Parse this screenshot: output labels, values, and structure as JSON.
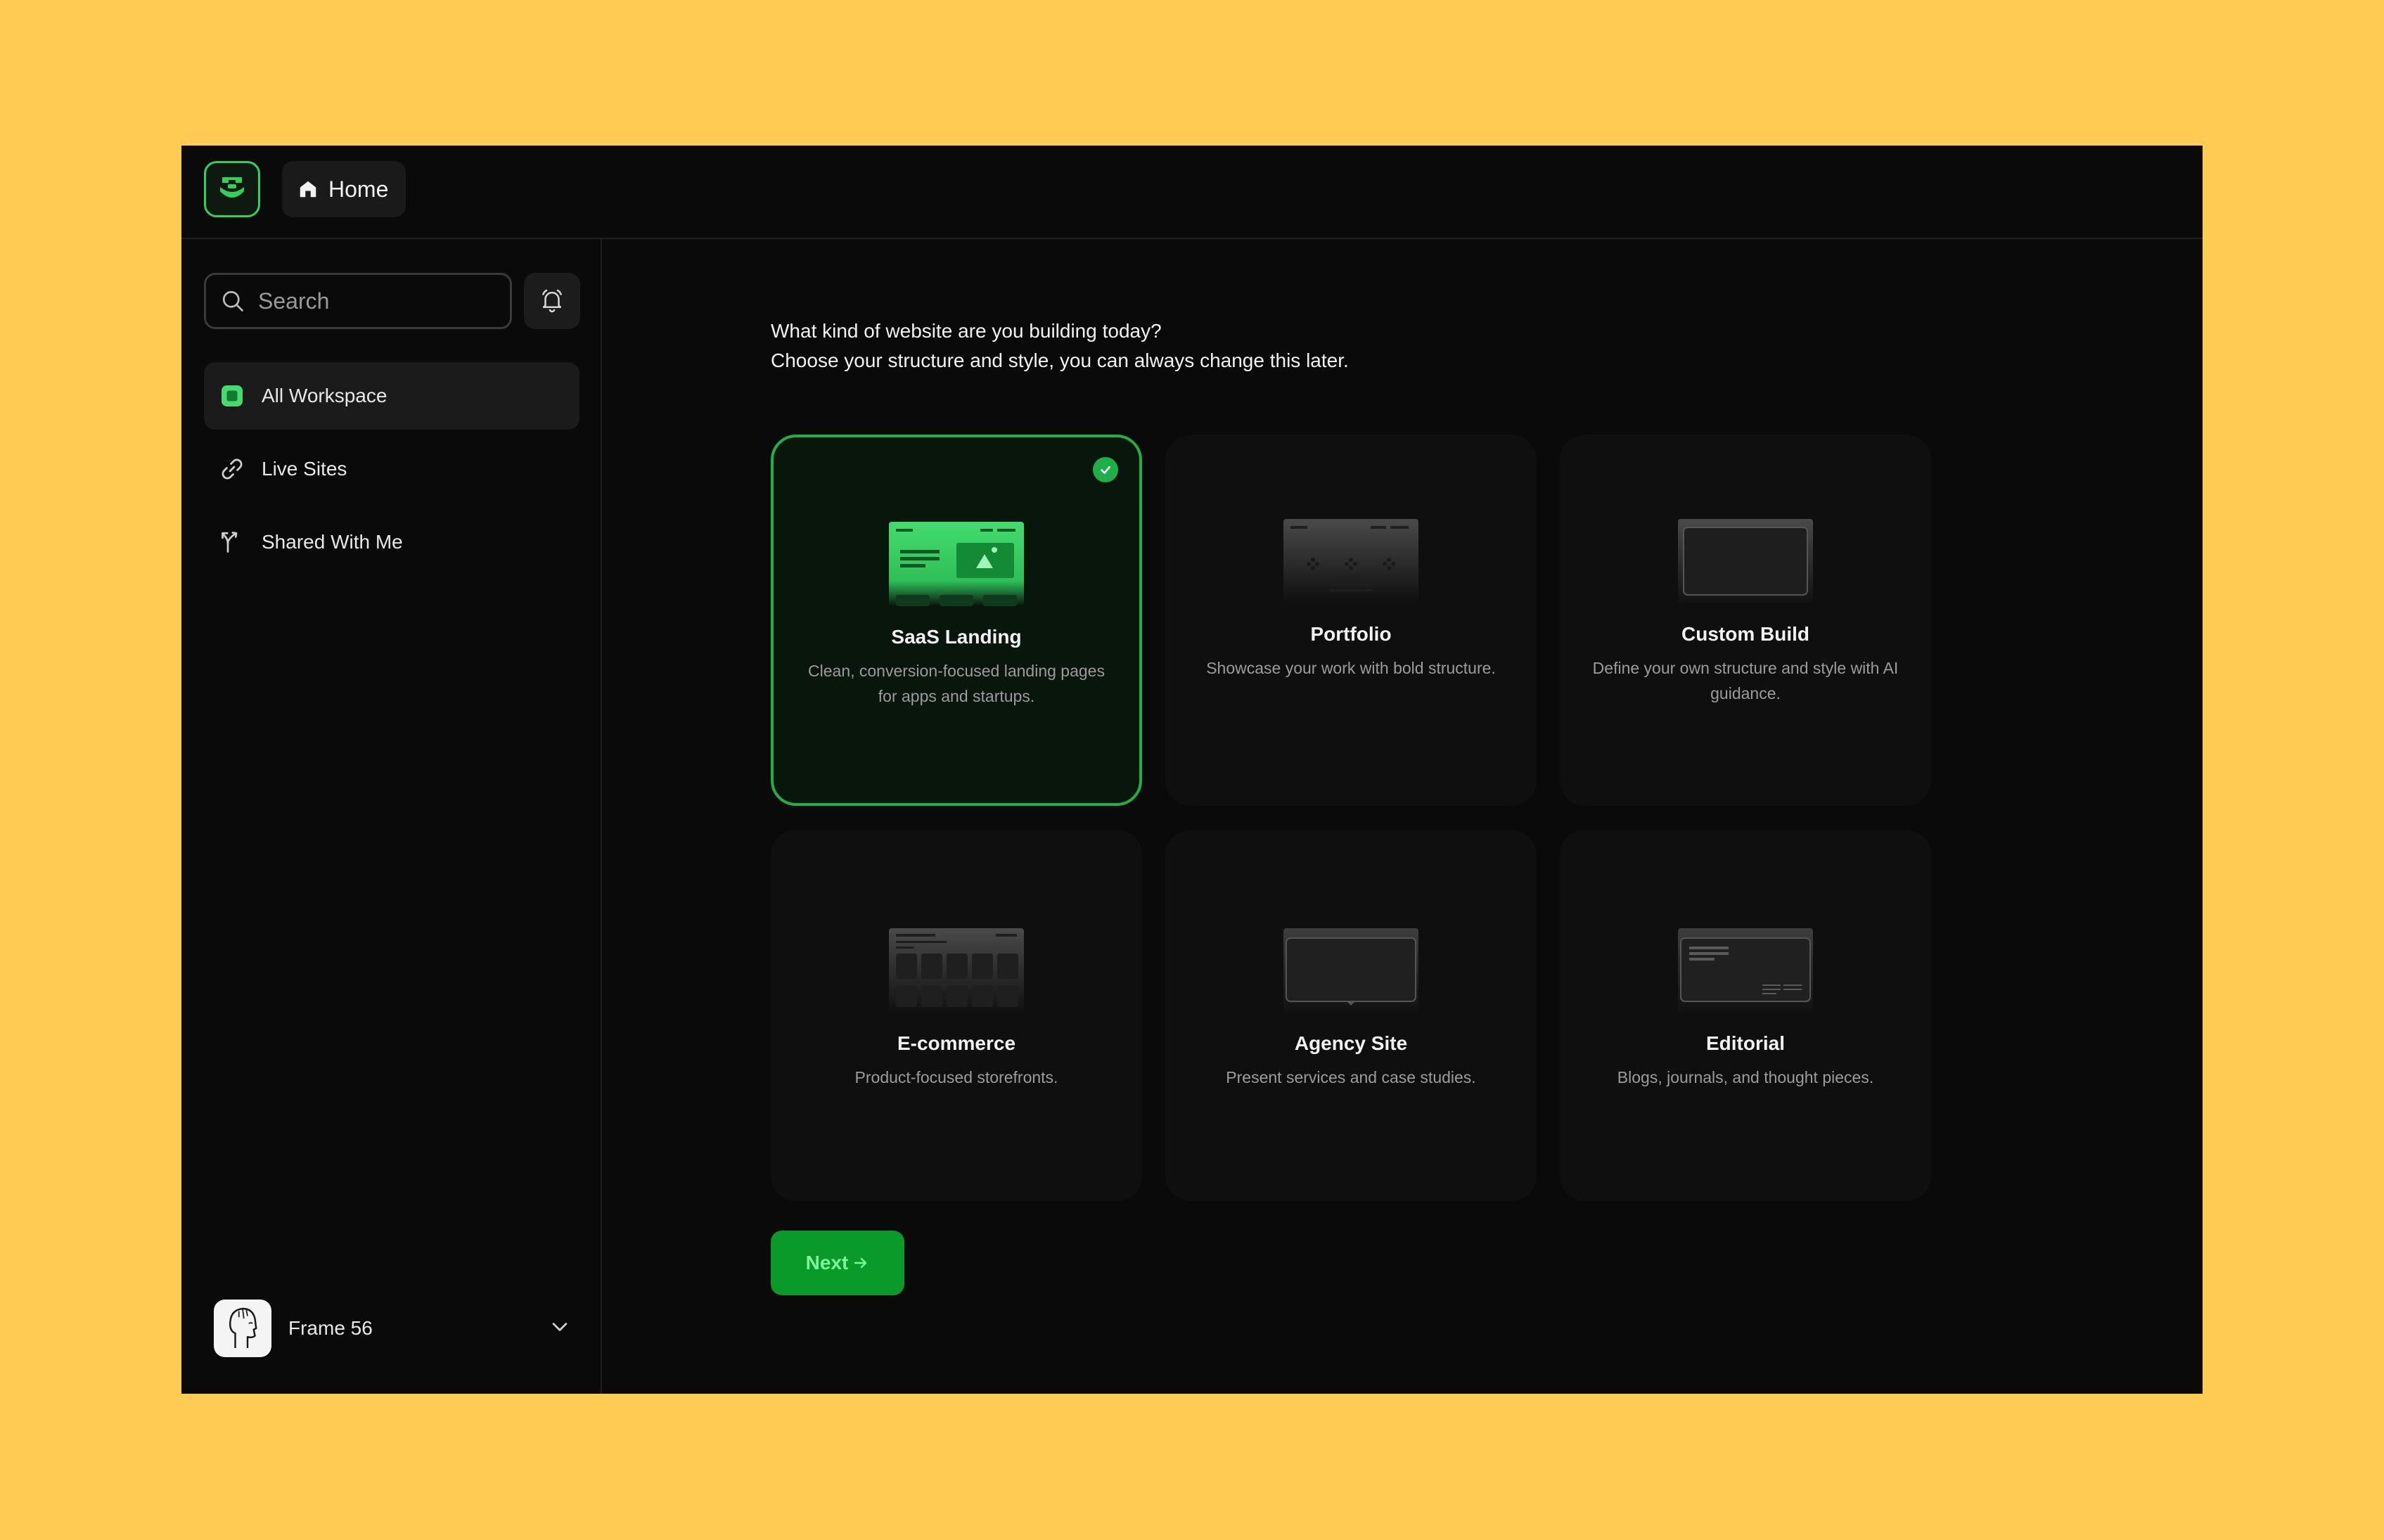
{
  "topbar": {
    "home_label": "Home"
  },
  "sidebar": {
    "search_placeholder": "Search",
    "items": [
      {
        "label": "All Workspace",
        "icon": "workspace-icon",
        "active": true
      },
      {
        "label": "Live Sites",
        "icon": "link-icon",
        "active": false
      },
      {
        "label": "Shared With Me",
        "icon": "share-arrow-icon",
        "active": false
      }
    ],
    "account": {
      "name": "Frame 56"
    }
  },
  "main": {
    "heading_line1": "What kind of website are you building today?",
    "heading_line2": "Choose your structure and style, you can always change this later.",
    "cards": [
      {
        "title": "SaaS Landing",
        "desc": "Clean, conversion-focused landing pages for apps and startups.",
        "selected": true
      },
      {
        "title": "Portfolio",
        "desc": "Showcase your work with bold structure.",
        "selected": false
      },
      {
        "title": "Custom Build",
        "desc": "Define your own structure and style with AI guidance.",
        "selected": false
      },
      {
        "title": "E-commerce",
        "desc": "Product-focused storefronts.",
        "selected": false
      },
      {
        "title": "Agency Site",
        "desc": "Present services and case studies.",
        "selected": false
      },
      {
        "title": "Editorial",
        "desc": "Blogs, journals, and thought pieces.",
        "selected": false
      }
    ],
    "next_label": "Next"
  },
  "colors": {
    "page_background": "#FFCB52",
    "app_background": "#0A0A0A",
    "accent_green": "#1EB048",
    "button_green": "#0A9A2A"
  }
}
